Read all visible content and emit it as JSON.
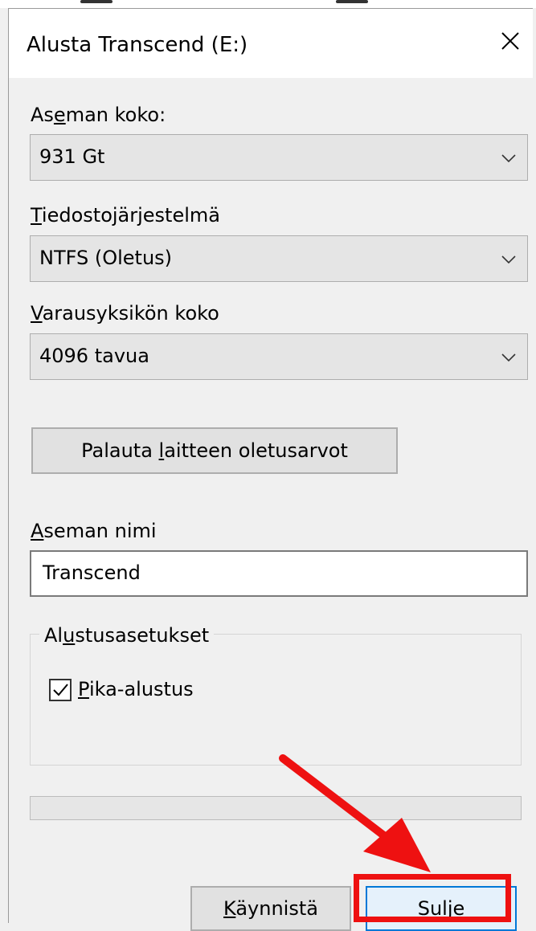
{
  "window": {
    "title": "Alusta Transcend (E:)"
  },
  "capacity": {
    "label_pre": "As",
    "label_key": "e",
    "label_post": "man koko:",
    "value": "931 Gt"
  },
  "filesystem": {
    "label_key": "T",
    "label_post": "iedostojärjestelmä",
    "value": "NTFS (Oletus)"
  },
  "allocation": {
    "label_key": "V",
    "label_post": "arausyksikön koko",
    "value": "4096 tavua"
  },
  "restore_button": {
    "pre": "Palauta ",
    "key": "l",
    "post": "aitteen oletusarvot"
  },
  "volume": {
    "label_key": "A",
    "label_post": "seman nimi",
    "value": "Transcend"
  },
  "options": {
    "title_pre": "Al",
    "title_key": "u",
    "title_post": "stusasetukset",
    "quick_key": "P",
    "quick_post": "ika-alustus",
    "quick_checked": true
  },
  "progress": {
    "value": 0
  },
  "buttons": {
    "start_key": "K",
    "start_post": "äynnistä",
    "close_key": "S",
    "close_post": "ulje"
  },
  "annotation": {
    "color": "#ee1111"
  }
}
